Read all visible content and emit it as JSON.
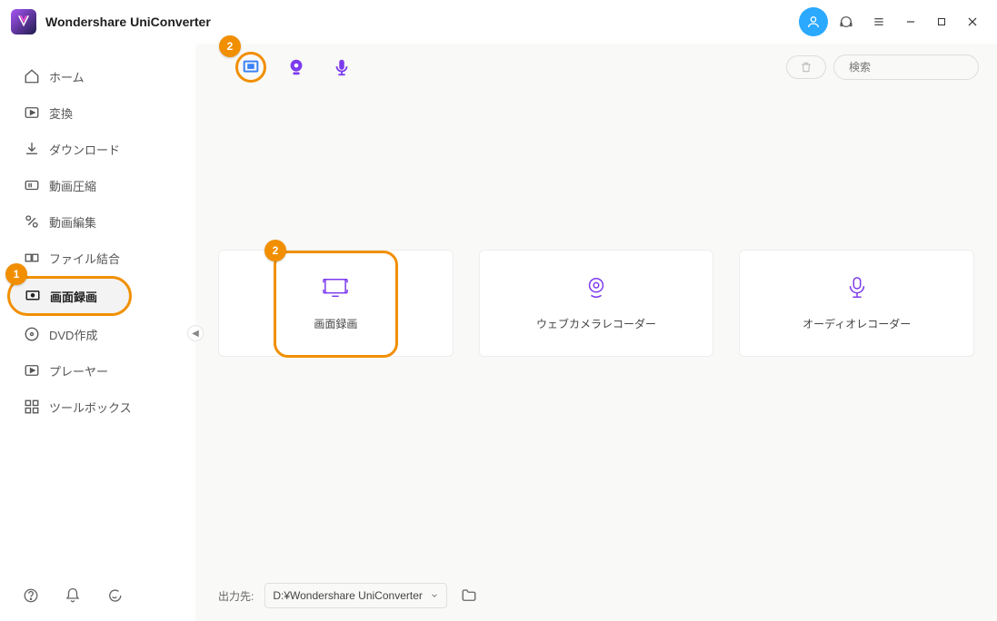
{
  "app": {
    "title": "Wondershare UniConverter"
  },
  "sidebar": {
    "items": [
      {
        "label": "ホーム"
      },
      {
        "label": "変換"
      },
      {
        "label": "ダウンロード"
      },
      {
        "label": "動画圧縮"
      },
      {
        "label": "動画編集"
      },
      {
        "label": "ファイル結合"
      },
      {
        "label": "画面録画"
      },
      {
        "label": "DVD作成"
      },
      {
        "label": "プレーヤー"
      },
      {
        "label": "ツールボックス"
      }
    ]
  },
  "annotations": {
    "badge1": "1",
    "badge2_sidebar": "2",
    "badge2_card": "2"
  },
  "search": {
    "placeholder": "検索"
  },
  "cards": {
    "screen": "画面録画",
    "webcam": "ウェブカメラレコーダー",
    "audio": "オーディオレコーダー"
  },
  "footer": {
    "label": "出力先:",
    "path": "D:¥Wondershare UniConverter"
  }
}
